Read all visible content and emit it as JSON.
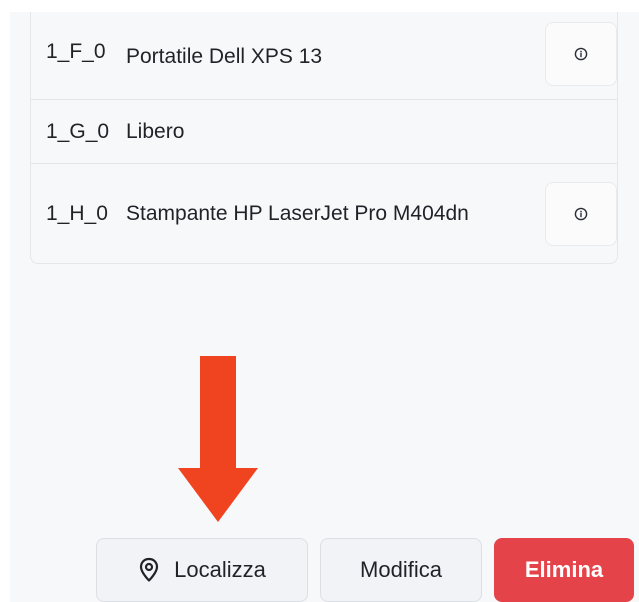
{
  "table": {
    "rows": [
      {
        "code": "1_F_0",
        "name": "Portatile Dell XPS 13",
        "has_info": true
      },
      {
        "code": "1_G_0",
        "name": "Libero",
        "has_info": false
      },
      {
        "code": "1_H_0",
        "name": "Stampante HP LaserJet Pro M404dn",
        "has_info": true
      }
    ]
  },
  "actions": {
    "locate_label": "Localizza",
    "edit_label": "Modifica",
    "delete_label": "Elimina"
  },
  "colors": {
    "arrow": "#f0431f",
    "delete_button": "#e5434a",
    "panel_background": "#f7f8fa"
  },
  "icons": {
    "info": "info-circle-icon",
    "locate": "map-pin-icon",
    "annotation": "arrow-down-icon"
  }
}
